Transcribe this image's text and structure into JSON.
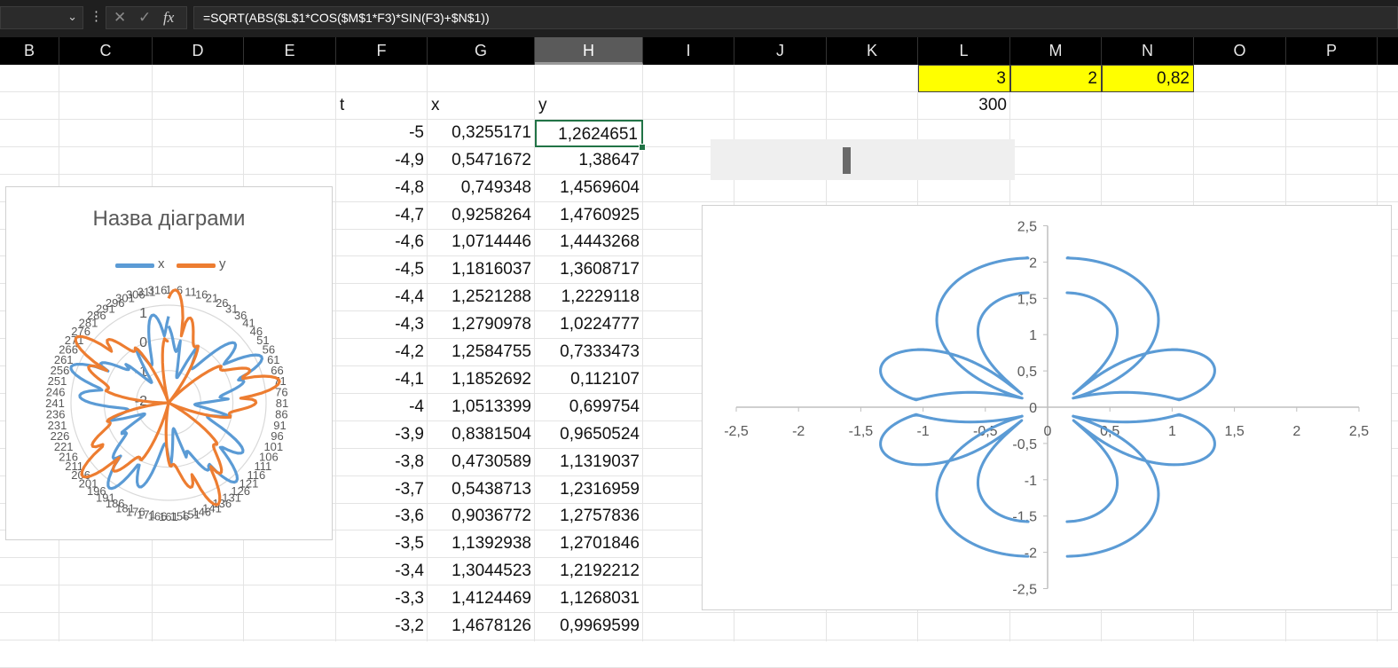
{
  "formula_bar": {
    "name_box": "",
    "cancel_icon": "close-icon",
    "enter_icon": "check-icon",
    "fx_label": "fx",
    "formula": "=SQRT(ABS($L$1*COS($M$1*F3)*SIN(F3)+$N$1))"
  },
  "columns": [
    "B",
    "C",
    "D",
    "E",
    "F",
    "G",
    "H",
    "I",
    "J",
    "K",
    "L",
    "M",
    "N",
    "O",
    "P"
  ],
  "selected_column": "H",
  "params": {
    "L1": "3",
    "M1": "2",
    "N1": "0,82",
    "L2": "300"
  },
  "headers": {
    "t": "t",
    "x": "x",
    "y": "y"
  },
  "rows": [
    [
      "-5",
      "0,3255171",
      "1,2624651"
    ],
    [
      "-4,9",
      "0,5471672",
      "1,38647"
    ],
    [
      "-4,8",
      "0,749348",
      "1,4569604"
    ],
    [
      "-4,7",
      "0,9258264",
      "1,4760925"
    ],
    [
      "-4,6",
      "1,0714446",
      "1,4443268"
    ],
    [
      "-4,5",
      "1,1816037",
      "1,3608717"
    ],
    [
      "-4,4",
      "1,2521288",
      "1,2229118"
    ],
    [
      "-4,3",
      "1,2790978",
      "1,0224777"
    ],
    [
      "-4,2",
      "1,2584755",
      "0,7333473"
    ],
    [
      "-4,1",
      "1,1852692",
      "0,112107"
    ],
    [
      "-4",
      "1,0513399",
      "0,699754"
    ],
    [
      "-3,9",
      "0,8381504",
      "0,9650524"
    ],
    [
      "-3,8",
      "0,4730589",
      "1,1319037"
    ],
    [
      "-3,7",
      "0,5438713",
      "1,2316959"
    ],
    [
      "-3,6",
      "0,9036772",
      "1,2757836"
    ],
    [
      "-3,5",
      "1,1392938",
      "1,2701846"
    ],
    [
      "-3,4",
      "1,3044523",
      "1,2192212"
    ],
    [
      "-3,3",
      "1,4124469",
      "1,1268031"
    ],
    [
      "-3,2",
      "1,4678126",
      "0,9969599"
    ]
  ],
  "radar_chart": {
    "title": "Назва діаграми",
    "legend": [
      {
        "name": "x",
        "color": "#5b9bd5"
      },
      {
        "name": "y",
        "color": "#ed7d31"
      }
    ],
    "radial_labels": [
      "1",
      "0",
      "-1",
      "-2"
    ]
  },
  "chart_data": {
    "type": "scatter",
    "title": "",
    "xlim": [
      -2.5,
      2.5
    ],
    "ylim": [
      -2.5,
      2.5
    ],
    "x_ticks": [
      "-2,5",
      "-2",
      "-1,5",
      "-1",
      "-0,5",
      "0",
      "0,5",
      "1",
      "1,5",
      "2",
      "2,5"
    ],
    "y_ticks": [
      "2,5",
      "2",
      "1,5",
      "1",
      "0,5",
      "0",
      "-0,5",
      "-1",
      "-1,5",
      "-2",
      "-2,5"
    ],
    "line_color": "#5b9bd5",
    "series": [
      {
        "description_params": {
          "L": 3,
          "M": 2,
          "N": 0.82
        },
        "t_range": [
          -5,
          25
        ],
        "t_step": 0.1
      }
    ]
  }
}
